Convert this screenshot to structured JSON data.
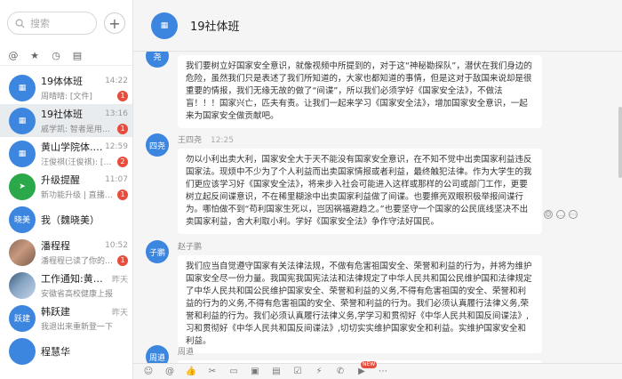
{
  "search": {
    "placeholder": "搜索"
  },
  "filters": [
    "@",
    "★",
    "◷",
    "▤"
  ],
  "conversations": [
    {
      "name": "19体体班",
      "time": "14:22",
      "preview": "周晴晴: [文件]",
      "badge": "1",
      "avatar_text": "",
      "avatar_color": "#3c86e0"
    },
    {
      "name": "19社体班",
      "time": "13:16",
      "preview": "戚学凯: 智者是用经验...",
      "badge": "1",
      "avatar_text": "",
      "avatar_color": "#3c86e0"
    },
    {
      "name": "黄山学院体...",
      "tag": "内部",
      "time": "12:59",
      "preview": "汪俊祺(汪俊祺): [签到]...",
      "badge": "2",
      "avatar_text": "",
      "avatar_color": "#3c86e0"
    },
    {
      "name": "升级提醒",
      "time": "11:07",
      "preview": "新功能升级 | 直播中支...",
      "badge": "1",
      "avatar_text": "",
      "avatar_color": "#2ba84a"
    },
    {
      "name": "我（魏晓美）",
      "time": "",
      "preview": "",
      "badge": "",
      "avatar_text": "晓美",
      "avatar_color": "#3c86e0"
    },
    {
      "name": "潘程程",
      "time": "10:52",
      "preview": "潘程程已读了你的DING",
      "badge": "1",
      "avatar_text": "",
      "avatar_color": "#8a6a5a"
    },
    {
      "name": "工作通知:黄山学...",
      "time": "昨天",
      "preview": "安徽省高校健康上报",
      "badge": "",
      "avatar_text": "",
      "avatar_color": "#3a5a7a"
    },
    {
      "name": "韩跃建",
      "time": "昨天",
      "preview": "我退出来重新登一下",
      "badge": "",
      "avatar_text": "跃建",
      "avatar_color": "#3c86e0"
    },
    {
      "name": "程慧华",
      "time": "",
      "preview": "",
      "badge": "",
      "avatar_text": "",
      "avatar_color": "#3c86e0"
    }
  ],
  "header": {
    "title": "19社体班"
  },
  "messages": [
    {
      "sender": "",
      "avatar_text": "",
      "text": "我们要树立好国家安全意识，就像视频中所提到的，对于这“神秘勘探队”，潜伏在我们身边的危险，虽然我们只是表述了我们所知道的，大家也都知道的事情，但是这对于敌国来说却是很重要的情报，我们无缘无故的做了“间谍”，所以我们必须学好《国家安全法》，不做法盲！！！国家兴亡，匹夫有责。让我们一起来学习《国家安全法》，增加国家安全意识，一起来为国家安全做贡献吧。"
    },
    {
      "sender": "王四尧",
      "time": "12:25",
      "avatar_text": "四尧",
      "text": "勿以小利出卖大利，国家安全大于天不能没有国家安全意识，在不知不觉中出卖国家利益违反国家法。现烦中不少为了个人利益而出卖国家情报或者利益，最终触犯法律。作为大学生的我们更应该学习好《国家安全法》，将来步入社会可能进入这样或那样的公司或部门工作，更要树立起反间谍意识，不在稀里糊涂中出卖国家利益做了间谍。也要擦亮双眼积极举报间谍行为。哪怕做不到“苟利国家生死以，岂因祸福避趋之。”也要坚守一个国家的公民底线坚决不出卖国家利益，舍大利取小利。学好《国家安全法》争作守法好国民。"
    },
    {
      "sender": "赵子鹏",
      "time": "",
      "avatar_text": "子鹏",
      "text": "我们应当自觉遵守国家有关法律法规，不做有危害祖国安全、荣誉和利益的行为，并将为维护国家安全尽一份力量。我国宪我国宪法法和法律规定了中华人民共和国公民维护国和法律规定了中华人民共和国公民维护国家安全、荣誉和利益的义务,不得有危害祖国的安全、荣誉和利益的行为的义务,不得有危害祖国的安全、荣誉和利益的行为。我们必须认真履行法律义务,荣誉和利益的行为。我们必须认真履行法律义务,学学习和贯彻好《中华人民共和国反间谍法》,习和贯彻好《中华人民共和国反间谍法》,切切实实维护国家安全和利益。实维护国家安全和利益。"
    },
    {
      "sender": "周遒",
      "time": "",
      "avatar_text": "周遒",
      "text": ""
    }
  ],
  "toolbar": {
    "new_label": "NEW"
  }
}
